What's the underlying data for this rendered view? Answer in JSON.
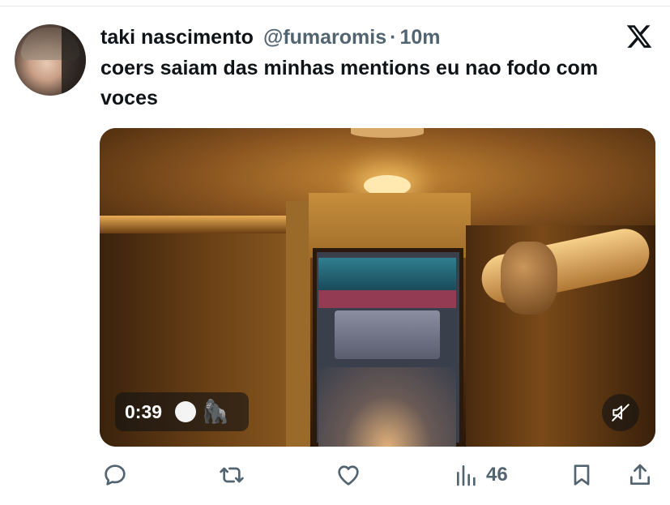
{
  "tweet": {
    "author_name": "taki nascimento",
    "author_handle": "@fumaromis",
    "separator": "·",
    "time_ago": "10m",
    "text": "coers saiam das minhas mentions eu nao fodo com voces"
  },
  "media": {
    "duration": "0:39",
    "emoji": "🦍",
    "muted": true
  },
  "actions": {
    "views_count": "46"
  },
  "icons": [
    "x-logo-icon",
    "reply-icon",
    "retweet-icon",
    "like-icon",
    "views-icon",
    "bookmark-icon",
    "share-icon",
    "muted-speaker-icon"
  ],
  "colors": {
    "text": "#0f1419",
    "secondary": "#536471"
  }
}
